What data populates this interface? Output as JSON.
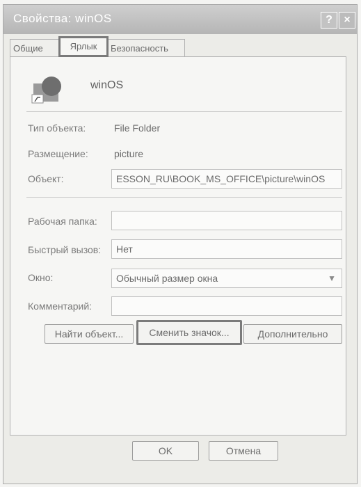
{
  "window": {
    "title": "Свойства: winOS"
  },
  "tabs": [
    {
      "label": "Общие"
    },
    {
      "label": "Ярлык"
    },
    {
      "label": "Безопасность"
    }
  ],
  "item": {
    "name": "winOS"
  },
  "properties": {
    "type_label": "Тип объекта:",
    "type_value": "File Folder",
    "location_label": "Размещение:",
    "location_value": "picture",
    "target_label": "Объект:",
    "target_value": "ESSON_RU\\BOOK_MS_OFFICE\\picture\\winOS",
    "workdir_label": "Рабочая папка:",
    "workdir_value": "",
    "hotkey_label": "Быстрый вызов:",
    "hotkey_value": "Нет",
    "window_label": "Окно:",
    "window_value": "Обычный размер окна",
    "comment_label": "Комментарий:",
    "comment_value": ""
  },
  "buttons": {
    "find": "Найти объект...",
    "change_icon": "Сменить значок...",
    "advanced": "Дополнительно",
    "ok": "OK",
    "cancel": "Отмена",
    "help": "?",
    "close": "×"
  },
  "icons": {
    "folder_shortcut": "folder-shortcut-icon",
    "dropdown": "chevron-down-icon"
  }
}
